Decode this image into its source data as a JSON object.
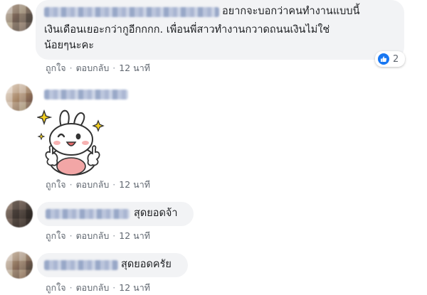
{
  "comments": [
    {
      "text_lines": [
        "อยากจะบอกว่าคนทำงานแบบนี้",
        "เงินเดือนเยอะกว่ากูอีกกกก. เพื่อนพี่สาวทำงานกวาดถนนเงินไม่ใช่",
        "น้อยๆนะคะ"
      ],
      "reaction_count": "2",
      "actions": {
        "like": "ถูกใจ",
        "reply": "ตอบกลับ",
        "time": "12 นาที"
      }
    },
    {
      "sticker": "white-bunny-thumbs-up",
      "actions": {
        "like": "ถูกใจ",
        "reply": "ตอบกลับ",
        "time": "12 นาที"
      }
    },
    {
      "text": "สุดยอดจ้า",
      "actions": {
        "like": "ถูกใจ",
        "reply": "ตอบกลับ",
        "time": "12 นาที"
      }
    },
    {
      "text": "สุดยอดครัย",
      "actions": {
        "like": "ถูกใจ",
        "reply": "ตอบกลับ",
        "time": "12 นาที"
      }
    }
  ],
  "colors": {
    "bubble": "#f2f3f5",
    "like_blue": "#1877f2",
    "meta_gray": "#606770"
  }
}
